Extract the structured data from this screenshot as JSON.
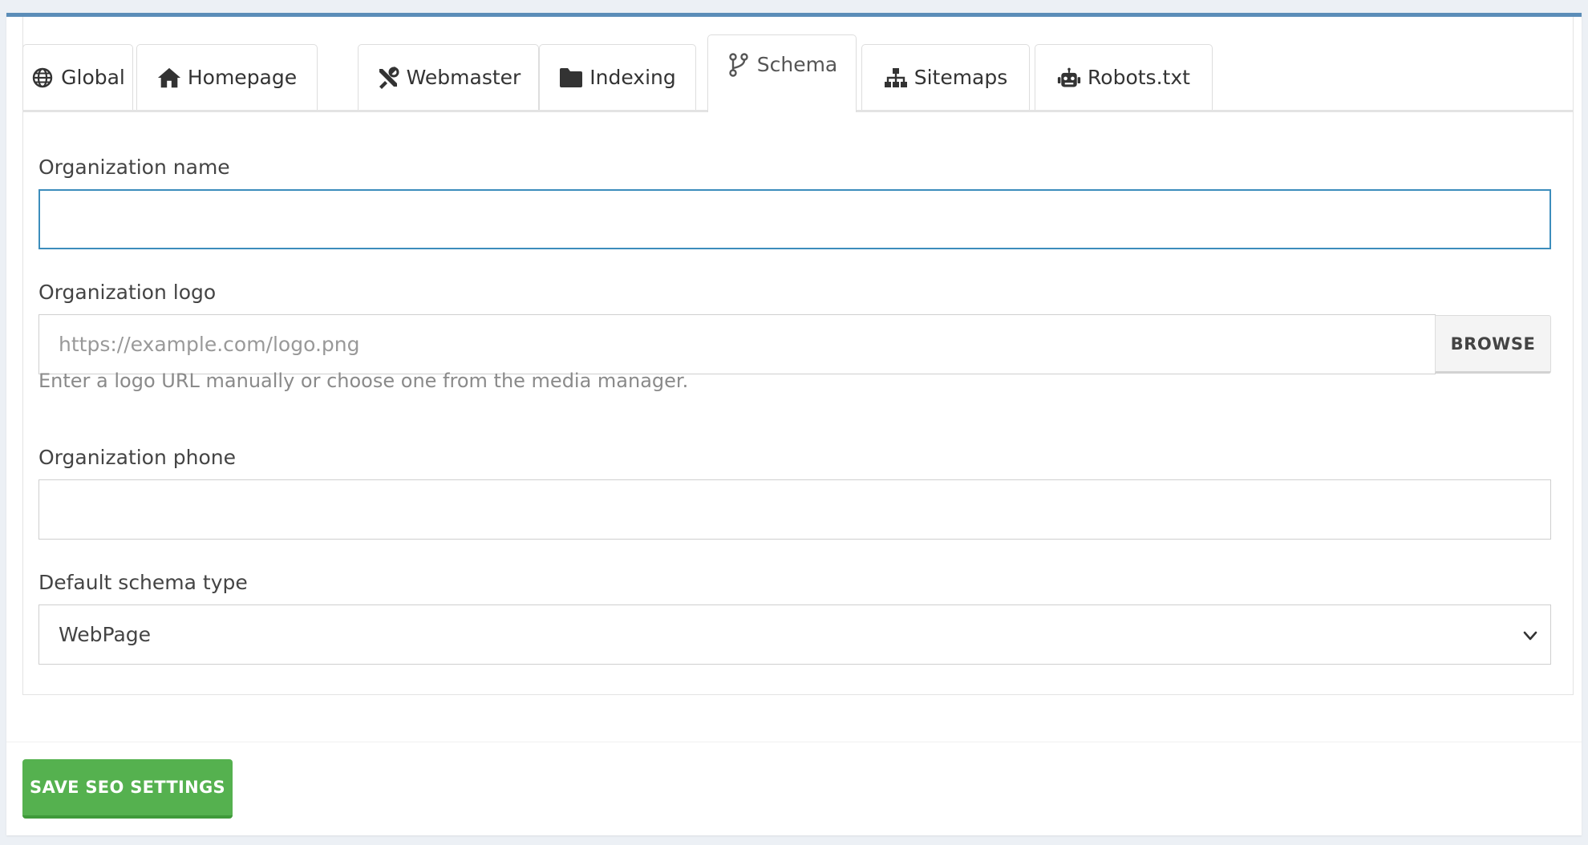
{
  "tabs": [
    {
      "label": "Global",
      "icon": "globe-icon",
      "active": false
    },
    {
      "label": "Homepage",
      "icon": "home-icon",
      "active": false
    },
    {
      "label": "Webmaster",
      "icon": "tools-icon",
      "active": false
    },
    {
      "label": "Indexing",
      "icon": "folder-icon",
      "active": false
    },
    {
      "label": "Schema",
      "icon": "code-branch-icon",
      "active": true
    },
    {
      "label": "Sitemaps",
      "icon": "sitemap-icon",
      "active": false
    },
    {
      "label": "Robots.txt",
      "icon": "robot-icon",
      "active": false
    }
  ],
  "form": {
    "org_name": {
      "label": "Organization name",
      "value": "",
      "placeholder": ""
    },
    "org_logo": {
      "label": "Organization logo",
      "value": "",
      "placeholder": "https://example.com/logo.png",
      "browse_label": "BROWSE",
      "help": "Enter a logo URL manually or choose one from the media manager."
    },
    "org_phone": {
      "label": "Organization phone",
      "value": "",
      "placeholder": ""
    },
    "schema_type": {
      "label": "Default schema type",
      "selected": "WebPage"
    }
  },
  "actions": {
    "save_label": "SAVE SEO SETTINGS"
  },
  "colors": {
    "box_top_border": "#5b8db8",
    "focus_border": "#3c8dbc",
    "save_button": "#55b14f",
    "page_background": "#ecf0f5"
  }
}
